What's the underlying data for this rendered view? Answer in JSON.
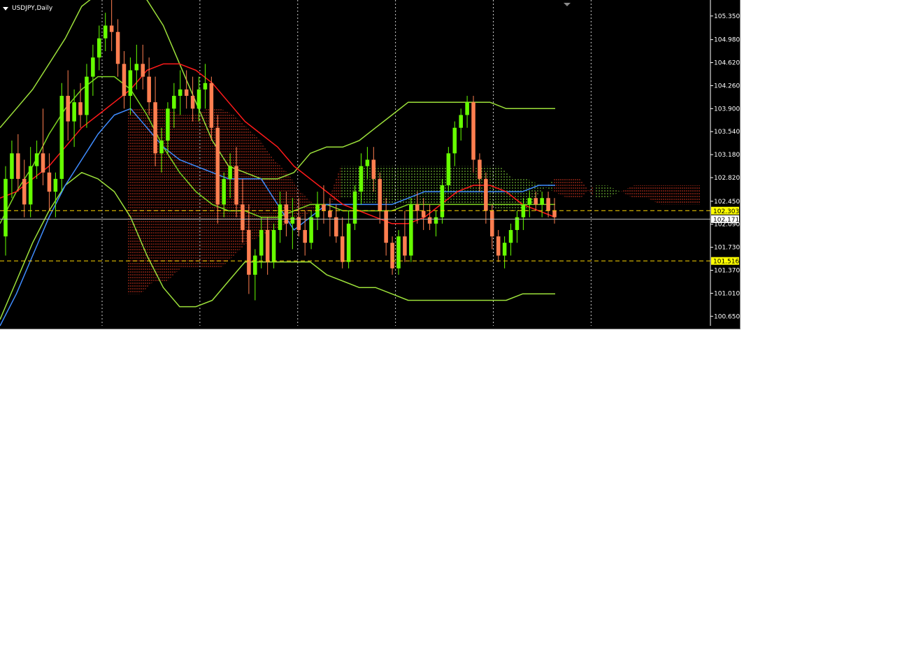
{
  "window": {
    "title": "USDJPY,Daily"
  },
  "colors": {
    "background": "#000000",
    "axis_text": "#ffffff",
    "grid": "#ffffff",
    "bull_candle": "#66ff00",
    "bear_candle": "#ff7f50",
    "level_line": "#ffd700",
    "price_label_bg": "#ffff00",
    "current_label_bg": "#ffffff"
  },
  "chart_data": {
    "type": "candlestick",
    "symbol": "USDJPY",
    "timeframe": "Daily",
    "ylim": [
      100.5,
      105.6
    ],
    "y_ticks": [
      100.65,
      101.01,
      101.37,
      101.73,
      102.09,
      102.45,
      102.82,
      103.18,
      103.54,
      103.9,
      104.26,
      104.62,
      104.98,
      105.35
    ],
    "y_tick_labels": [
      "100.650",
      "101.010",
      "101.370",
      "101.730",
      "102.090",
      "102.450",
      "102.820",
      "103.180",
      "103.540",
      "103.900",
      "104.260",
      "104.620",
      "104.980",
      "105.350"
    ],
    "vertical_grid_count": 6,
    "horizontal_levels": [
      {
        "value": 102.303,
        "label": "102.303"
      },
      {
        "value": 101.516,
        "label": "101.516"
      }
    ],
    "current_price": {
      "value": 102.171,
      "label": "102.171"
    },
    "candles": [
      {
        "o": 101.9,
        "h": 103.0,
        "l": 101.6,
        "c": 102.8
      },
      {
        "o": 102.8,
        "h": 103.4,
        "l": 102.5,
        "c": 103.2
      },
      {
        "o": 103.2,
        "h": 103.5,
        "l": 102.6,
        "c": 102.8
      },
      {
        "o": 102.8,
        "h": 103.1,
        "l": 102.2,
        "c": 102.4
      },
      {
        "o": 102.4,
        "h": 103.3,
        "l": 102.2,
        "c": 103.0
      },
      {
        "o": 103.0,
        "h": 103.4,
        "l": 102.8,
        "c": 103.2
      },
      {
        "o": 103.2,
        "h": 103.9,
        "l": 102.7,
        "c": 102.9
      },
      {
        "o": 102.9,
        "h": 103.2,
        "l": 102.3,
        "c": 102.6
      },
      {
        "o": 102.6,
        "h": 102.9,
        "l": 102.2,
        "c": 102.8
      },
      {
        "o": 102.8,
        "h": 104.3,
        "l": 102.6,
        "c": 104.1
      },
      {
        "o": 104.1,
        "h": 104.5,
        "l": 103.4,
        "c": 103.7
      },
      {
        "o": 103.7,
        "h": 104.2,
        "l": 103.3,
        "c": 104.0
      },
      {
        "o": 104.0,
        "h": 104.3,
        "l": 103.6,
        "c": 103.8
      },
      {
        "o": 103.8,
        "h": 104.6,
        "l": 103.6,
        "c": 104.4
      },
      {
        "o": 104.4,
        "h": 104.9,
        "l": 104.1,
        "c": 104.7
      },
      {
        "o": 104.7,
        "h": 105.2,
        "l": 104.5,
        "c": 105.0
      },
      {
        "o": 105.0,
        "h": 105.4,
        "l": 104.8,
        "c": 105.2
      },
      {
        "o": 105.2,
        "h": 105.6,
        "l": 104.8,
        "c": 105.1
      },
      {
        "o": 105.1,
        "h": 105.3,
        "l": 104.4,
        "c": 104.6
      },
      {
        "o": 104.6,
        "h": 104.8,
        "l": 103.9,
        "c": 104.1
      },
      {
        "o": 104.1,
        "h": 104.7,
        "l": 103.8,
        "c": 104.5
      },
      {
        "o": 104.5,
        "h": 104.9,
        "l": 104.2,
        "c": 104.6
      },
      {
        "o": 104.6,
        "h": 104.9,
        "l": 104.2,
        "c": 104.4
      },
      {
        "o": 104.4,
        "h": 104.7,
        "l": 103.8,
        "c": 104.0
      },
      {
        "o": 104.0,
        "h": 104.4,
        "l": 103.0,
        "c": 103.2
      },
      {
        "o": 103.2,
        "h": 103.6,
        "l": 102.9,
        "c": 103.4
      },
      {
        "o": 103.4,
        "h": 104.0,
        "l": 103.2,
        "c": 103.9
      },
      {
        "o": 103.9,
        "h": 104.3,
        "l": 103.6,
        "c": 104.1
      },
      {
        "o": 104.1,
        "h": 104.5,
        "l": 103.8,
        "c": 104.2
      },
      {
        "o": 104.2,
        "h": 104.5,
        "l": 103.9,
        "c": 104.1
      },
      {
        "o": 104.1,
        "h": 104.4,
        "l": 103.7,
        "c": 103.9
      },
      {
        "o": 103.9,
        "h": 104.4,
        "l": 103.7,
        "c": 104.2
      },
      {
        "o": 104.2,
        "h": 104.6,
        "l": 103.9,
        "c": 104.3
      },
      {
        "o": 104.3,
        "h": 104.4,
        "l": 103.4,
        "c": 103.6
      },
      {
        "o": 103.6,
        "h": 103.8,
        "l": 102.1,
        "c": 102.4
      },
      {
        "o": 102.4,
        "h": 102.9,
        "l": 102.2,
        "c": 102.8
      },
      {
        "o": 102.8,
        "h": 103.2,
        "l": 102.5,
        "c": 103.0
      },
      {
        "o": 103.0,
        "h": 103.3,
        "l": 102.2,
        "c": 102.4
      },
      {
        "o": 102.4,
        "h": 102.8,
        "l": 101.8,
        "c": 102.0
      },
      {
        "o": 102.0,
        "h": 102.4,
        "l": 101.0,
        "c": 101.3
      },
      {
        "o": 101.3,
        "h": 101.7,
        "l": 100.9,
        "c": 101.6
      },
      {
        "o": 101.6,
        "h": 102.2,
        "l": 101.4,
        "c": 102.0
      },
      {
        "o": 102.0,
        "h": 102.2,
        "l": 101.3,
        "c": 101.5
      },
      {
        "o": 101.5,
        "h": 102.1,
        "l": 101.4,
        "c": 102.0
      },
      {
        "o": 102.0,
        "h": 102.6,
        "l": 101.8,
        "c": 102.4
      },
      {
        "o": 102.4,
        "h": 102.6,
        "l": 101.9,
        "c": 102.1
      },
      {
        "o": 102.1,
        "h": 102.5,
        "l": 101.7,
        "c": 102.2
      },
      {
        "o": 102.2,
        "h": 102.5,
        "l": 101.9,
        "c": 102.0
      },
      {
        "o": 102.0,
        "h": 102.3,
        "l": 101.6,
        "c": 101.8
      },
      {
        "o": 101.8,
        "h": 102.3,
        "l": 101.7,
        "c": 102.2
      },
      {
        "o": 102.2,
        "h": 102.6,
        "l": 102.0,
        "c": 102.4
      },
      {
        "o": 102.4,
        "h": 102.7,
        "l": 102.1,
        "c": 102.3
      },
      {
        "o": 102.3,
        "h": 102.5,
        "l": 101.9,
        "c": 102.2
      },
      {
        "o": 102.2,
        "h": 102.4,
        "l": 101.8,
        "c": 101.9
      },
      {
        "o": 101.9,
        "h": 102.2,
        "l": 101.4,
        "c": 101.5
      },
      {
        "o": 101.5,
        "h": 102.3,
        "l": 101.4,
        "c": 102.1
      },
      {
        "o": 102.1,
        "h": 102.7,
        "l": 102.0,
        "c": 102.6
      },
      {
        "o": 102.6,
        "h": 103.2,
        "l": 102.4,
        "c": 103.0
      },
      {
        "o": 103.0,
        "h": 103.3,
        "l": 102.8,
        "c": 103.1
      },
      {
        "o": 103.1,
        "h": 103.3,
        "l": 102.6,
        "c": 102.8
      },
      {
        "o": 102.8,
        "h": 102.9,
        "l": 102.1,
        "c": 102.3
      },
      {
        "o": 102.3,
        "h": 102.5,
        "l": 101.6,
        "c": 101.8
      },
      {
        "o": 101.8,
        "h": 101.9,
        "l": 101.3,
        "c": 101.4
      },
      {
        "o": 101.4,
        "h": 102.0,
        "l": 101.3,
        "c": 101.9
      },
      {
        "o": 101.9,
        "h": 102.3,
        "l": 101.5,
        "c": 101.6
      },
      {
        "o": 101.6,
        "h": 102.5,
        "l": 101.5,
        "c": 102.4
      },
      {
        "o": 102.4,
        "h": 102.6,
        "l": 102.1,
        "c": 102.3
      },
      {
        "o": 102.3,
        "h": 102.5,
        "l": 102.0,
        "c": 102.2
      },
      {
        "o": 102.2,
        "h": 102.4,
        "l": 102.0,
        "c": 102.1
      },
      {
        "o": 102.1,
        "h": 102.3,
        "l": 101.9,
        "c": 102.2
      },
      {
        "o": 102.2,
        "h": 102.8,
        "l": 102.1,
        "c": 102.7
      },
      {
        "o": 102.7,
        "h": 103.3,
        "l": 102.6,
        "c": 103.2
      },
      {
        "o": 103.2,
        "h": 103.7,
        "l": 103.0,
        "c": 103.6
      },
      {
        "o": 103.6,
        "h": 103.9,
        "l": 103.4,
        "c": 103.8
      },
      {
        "o": 103.8,
        "h": 104.1,
        "l": 103.6,
        "c": 104.0
      },
      {
        "o": 104.0,
        "h": 104.1,
        "l": 102.9,
        "c": 103.1
      },
      {
        "o": 103.1,
        "h": 103.2,
        "l": 102.6,
        "c": 102.8
      },
      {
        "o": 102.8,
        "h": 102.9,
        "l": 102.1,
        "c": 102.3
      },
      {
        "o": 102.3,
        "h": 102.4,
        "l": 101.7,
        "c": 101.9
      },
      {
        "o": 101.9,
        "h": 102.0,
        "l": 101.5,
        "c": 101.6
      },
      {
        "o": 101.6,
        "h": 101.9,
        "l": 101.4,
        "c": 101.8
      },
      {
        "o": 101.8,
        "h": 102.1,
        "l": 101.6,
        "c": 102.0
      },
      {
        "o": 102.0,
        "h": 102.3,
        "l": 101.8,
        "c": 102.2
      },
      {
        "o": 102.2,
        "h": 102.5,
        "l": 102.0,
        "c": 102.4
      },
      {
        "o": 102.4,
        "h": 102.6,
        "l": 102.2,
        "c": 102.5
      },
      {
        "o": 102.5,
        "h": 102.6,
        "l": 102.3,
        "c": 102.4
      },
      {
        "o": 102.4,
        "h": 102.6,
        "l": 102.2,
        "c": 102.5
      },
      {
        "o": 102.5,
        "h": 102.6,
        "l": 102.2,
        "c": 102.3
      },
      {
        "o": 102.3,
        "h": 102.5,
        "l": 102.1,
        "c": 102.2
      }
    ],
    "indicators": {
      "ma_red": [
        102.5,
        102.6,
        102.8,
        103.0,
        103.3,
        103.6,
        103.8,
        104.0,
        104.2,
        104.5,
        104.6,
        104.6,
        104.5,
        104.3,
        104.0,
        103.7,
        103.5,
        103.3,
        103.0,
        102.8,
        102.6,
        102.4,
        102.3,
        102.2,
        102.1,
        102.1,
        102.2,
        102.4,
        102.6,
        102.7,
        102.7,
        102.6,
        102.4,
        102.3,
        102.2
      ],
      "ma_blue": [
        100.5,
        101.0,
        101.6,
        102.2,
        102.7,
        103.1,
        103.5,
        103.8,
        103.9,
        103.6,
        103.3,
        103.1,
        103.0,
        102.9,
        102.8,
        102.8,
        102.8,
        102.4,
        102.0,
        102.2,
        102.4,
        102.4,
        102.4,
        102.4,
        102.4,
        102.5,
        102.6,
        102.6,
        102.6,
        102.6,
        102.6,
        102.6,
        102.6,
        102.7,
        102.7
      ],
      "bb_upper": [
        103.6,
        103.9,
        104.2,
        104.6,
        105.0,
        105.5,
        105.7,
        105.8,
        105.8,
        105.6,
        105.2,
        104.6,
        104.0,
        103.4,
        103.0,
        102.9,
        102.8,
        102.8,
        102.9,
        103.2,
        103.3,
        103.3,
        103.4,
        103.6,
        103.8,
        104.0,
        104.0,
        104.0,
        104.0,
        104.0,
        104.0,
        103.9,
        103.9,
        103.9,
        103.9
      ],
      "bb_middle": [
        102.1,
        102.6,
        103.0,
        103.5,
        103.9,
        104.2,
        104.4,
        104.4,
        104.2,
        103.8,
        103.3,
        102.9,
        102.6,
        102.4,
        102.3,
        102.3,
        102.2,
        102.2,
        102.3,
        102.4,
        102.4,
        102.3,
        102.3,
        102.3,
        102.3,
        102.4,
        102.4,
        102.4,
        102.4,
        102.4,
        102.4,
        102.4,
        102.4,
        102.4,
        102.4
      ],
      "bb_lower": [
        100.6,
        101.2,
        101.8,
        102.3,
        102.7,
        102.9,
        102.8,
        102.6,
        102.2,
        101.6,
        101.1,
        100.8,
        100.8,
        100.9,
        101.2,
        101.5,
        101.5,
        101.5,
        101.5,
        101.5,
        101.3,
        101.2,
        101.1,
        101.1,
        101.0,
        100.9,
        100.9,
        100.9,
        100.9,
        100.9,
        100.9,
        100.9,
        101.0,
        101.0,
        101.0
      ],
      "ichimoku_cloud": [
        {
          "a": 103.9,
          "b": 101.0
        },
        {
          "a": 103.9,
          "b": 101.0
        },
        {
          "a": 103.9,
          "b": 101.2
        },
        {
          "a": 103.9,
          "b": 101.2
        },
        {
          "a": 103.8,
          "b": 101.4
        },
        {
          "a": 103.8,
          "b": 101.4
        },
        {
          "a": 103.9,
          "b": 101.4
        },
        {
          "a": 103.9,
          "b": 101.4
        },
        {
          "a": 103.8,
          "b": 101.6
        },
        {
          "a": 103.6,
          "b": 101.8
        },
        {
          "a": 103.4,
          "b": 101.9
        },
        {
          "a": 103.1,
          "b": 102.0
        },
        {
          "a": 102.9,
          "b": 102.1
        },
        {
          "a": 102.6,
          "b": 102.2
        },
        {
          "a": 102.4,
          "b": 102.3
        },
        {
          "a": 102.4,
          "b": 102.4
        },
        {
          "a": 102.5,
          "b": 103.0
        },
        {
          "a": 102.5,
          "b": 103.0
        },
        {
          "a": 102.4,
          "b": 103.0
        },
        {
          "a": 102.4,
          "b": 103.0
        },
        {
          "a": 102.4,
          "b": 103.0
        },
        {
          "a": 102.4,
          "b": 103.0
        },
        {
          "a": 102.4,
          "b": 103.0
        },
        {
          "a": 102.4,
          "b": 103.0
        },
        {
          "a": 102.4,
          "b": 103.0
        },
        {
          "a": 102.4,
          "b": 103.0
        },
        {
          "a": 102.4,
          "b": 103.0
        },
        {
          "a": 102.4,
          "b": 103.0
        },
        {
          "a": 102.3,
          "b": 103.0
        },
        {
          "a": 102.3,
          "b": 102.8
        },
        {
          "a": 102.3,
          "b": 102.8
        },
        {
          "a": 102.6,
          "b": 102.7
        },
        {
          "a": 102.8,
          "b": 102.6
        },
        {
          "a": 102.8,
          "b": 102.5
        },
        {
          "a": 102.8,
          "b": 102.5
        },
        {
          "a": 102.5,
          "b": 102.7
        },
        {
          "a": 102.5,
          "b": 102.7
        },
        {
          "a": 102.6,
          "b": 102.6
        },
        {
          "a": 102.7,
          "b": 102.5
        },
        {
          "a": 102.7,
          "b": 102.5
        },
        {
          "a": 102.7,
          "b": 102.4
        },
        {
          "a": 102.7,
          "b": 102.4
        },
        {
          "a": 102.7,
          "b": 102.4
        },
        {
          "a": 102.7,
          "b": 102.4
        }
      ]
    }
  }
}
